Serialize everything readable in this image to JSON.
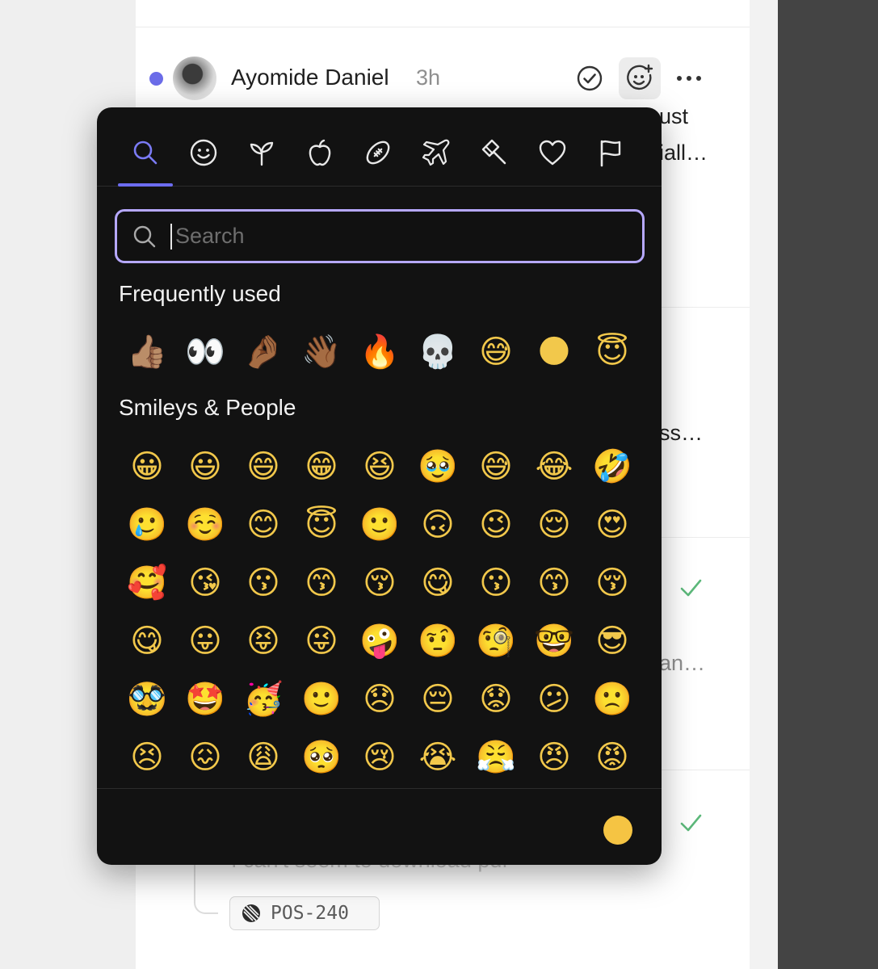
{
  "comment": {
    "author": "Ayomide Daniel",
    "time": "3h"
  },
  "fragments": {
    "line1_tail": "ust",
    "line2_tail": "iall…",
    "line3_tail": "ss…",
    "line4_tail": "an…",
    "faded_message": "I can't seem to download pdf"
  },
  "ticket": {
    "label": "POS-240"
  },
  "picker": {
    "tabs": [
      {
        "name": "search",
        "icon": "search-icon"
      },
      {
        "name": "smileys",
        "icon": "smiley-icon"
      },
      {
        "name": "nature",
        "icon": "sprout-icon"
      },
      {
        "name": "food",
        "icon": "apple-icon"
      },
      {
        "name": "activities",
        "icon": "football-icon"
      },
      {
        "name": "travel",
        "icon": "airplane-icon"
      },
      {
        "name": "objects",
        "icon": "hammer-icon"
      },
      {
        "name": "symbols",
        "icon": "heart-icon"
      },
      {
        "name": "flags",
        "icon": "flag-icon"
      }
    ],
    "search_placeholder": "Search",
    "frequently_used_title": "Frequently used",
    "frequently_used": [
      "👍🏽",
      "👀",
      "🤌🏾",
      "👋🏾",
      "🔥",
      "💀",
      "😅",
      "🌑",
      "😇"
    ],
    "smileys_title": "Smileys & People",
    "smileys": [
      "😀",
      "😃",
      "😄",
      "😁",
      "😆",
      "🥹",
      "😅",
      "😂",
      "🤣",
      "🥲",
      "☺️",
      "😊",
      "😇",
      "🙂",
      "🙃",
      "😉",
      "😌",
      "😍",
      "🥰",
      "😘",
      "😗",
      "😙",
      "😚",
      "😋",
      "😗",
      "😙",
      "😚",
      "😋",
      "😛",
      "😝",
      "😜",
      "🤪",
      "🤨",
      "🧐",
      "🤓",
      "😎",
      "🥸",
      "🤩",
      "🥳",
      "🙂",
      "😞",
      "😔",
      "😟",
      "😕",
      "🙁",
      "😣",
      "😖",
      "😩",
      "🥺",
      "😢",
      "😭",
      "😤",
      "😠",
      "😡"
    ],
    "skin_tone_color": "#f5c443",
    "accent_color": "#6c6cf0"
  }
}
